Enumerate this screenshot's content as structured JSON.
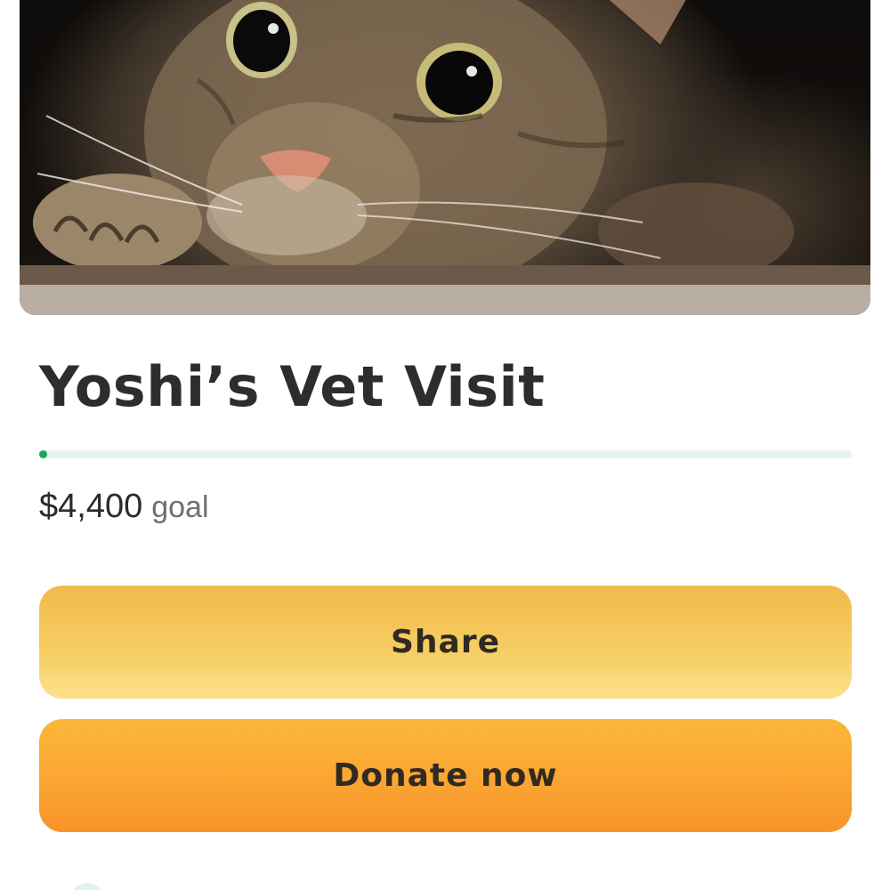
{
  "campaign": {
    "title": "Yoshi’s Vet Visit",
    "progress_fraction": 0.004,
    "goal_amount": "$4,400",
    "goal_label": "goal"
  },
  "actions": {
    "share_label": "Share",
    "donate_label": "Donate now"
  },
  "colors": {
    "progress_fill": "#19a55d",
    "progress_track": "#e6f4ee",
    "share_button": "#f4c254",
    "donate_button": "#fba532"
  },
  "hero": {
    "subject": "tabby cat photo"
  }
}
